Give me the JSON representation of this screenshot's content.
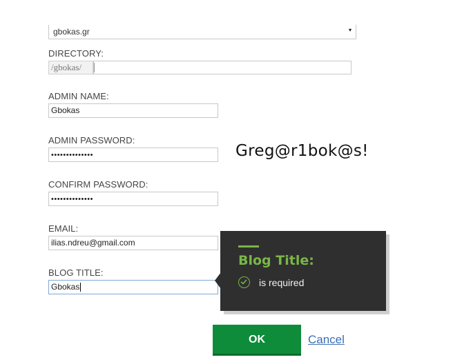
{
  "domain_select": {
    "value": "gbokas.gr",
    "arrow": "▾"
  },
  "directory": {
    "label": "DIRECTORY:",
    "prefix": "/gbokas/",
    "value": ""
  },
  "admin_name": {
    "label": "ADMIN NAME:",
    "value": "Gbokas"
  },
  "admin_password": {
    "label": "ADMIN PASSWORD:",
    "value": "••••••••••••••"
  },
  "confirm_password": {
    "label": "CONFIRM PASSWORD:",
    "value": "••••••••••••••"
  },
  "email": {
    "label": "EMAIL:",
    "value": "ilias.ndreu@gmail.com"
  },
  "blog_title": {
    "label": "BLOG TITLE:",
    "value": "Gbokas"
  },
  "annotation": {
    "text": "Greg@r1bok@s!"
  },
  "tooltip": {
    "title": "Blog Title:",
    "message": "is required",
    "icon": "check-circle-icon",
    "accent": "#7ab648",
    "background": "#2f2f2f"
  },
  "buttons": {
    "ok": "OK",
    "cancel": "Cancel",
    "ok_color": "#0e8c3a"
  }
}
